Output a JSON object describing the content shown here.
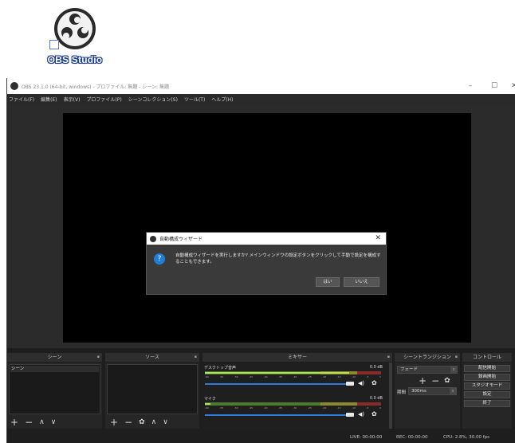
{
  "desktop": {
    "icon_label": "OBS Studio",
    "icon_name": "obs-logo-icon"
  },
  "window": {
    "title": "OBS 23.1.0 (64-bit, windows) - プロファイル: 無題 - シーン: 無題",
    "minimize_glyph": "–",
    "maximize_glyph": "☐",
    "close_glyph": "✕"
  },
  "menu": [
    "ファイル(F)",
    "編集(E)",
    "表示(V)",
    "プロファイル(P)",
    "シーンコレクション(S)",
    "ツール(T)",
    "ヘルプ(H)"
  ],
  "dialog": {
    "title": "自動構成ウィザード",
    "close_glyph": "✕",
    "icon_glyph": "?",
    "message": "自動構成ウィザードを実行しますか? メインウィンドウの設定ボタンをクリックして手動で設定を構成することもできます。",
    "yes_label": "はい",
    "no_label": "いいえ"
  },
  "docks": {
    "scenes": {
      "title": "シーン",
      "items": [
        "シーン"
      ]
    },
    "sources": {
      "title": "ソース"
    },
    "mixer": {
      "title": "ミキサー",
      "tracks": [
        {
          "name": "デスクトップ音声",
          "db": "0.0 dB",
          "level": 0.82,
          "volume": 1.0
        },
        {
          "name": "マイク",
          "db": "0.0 dB",
          "level": 0.03,
          "volume": 1.0
        }
      ],
      "scale": [
        "-60",
        "-55",
        "-50",
        "-45",
        "-40",
        "-35",
        "-30",
        "-25",
        "-20",
        "-15",
        "-10",
        "-5",
        "0"
      ]
    },
    "transitions": {
      "title": "シーントランジション",
      "selected": "フェード",
      "duration_label": "期間",
      "duration_value": "300ms"
    },
    "controls": {
      "title": "コントロール",
      "buttons": [
        "配信開始",
        "録画開始",
        "スタジオモード",
        "設定",
        "終了"
      ]
    }
  },
  "toolbar_glyphs": {
    "add": "+",
    "remove": "−",
    "gear": "✿",
    "up": "∧",
    "down": "∨",
    "volume": "◀)",
    "pin": "▪"
  },
  "status": {
    "live": "LIVE: 00:00:00",
    "rec": "REC: 00:00:00",
    "cpu": "CPU: 2.8%, 30.00 fps"
  },
  "colors": {
    "accent_blue": "#1f7fd6",
    "slider_blue": "#2d7ae0",
    "meter_green": "#4a7a2e",
    "meter_yellow": "#8a8a2a",
    "meter_red": "#8a2a2a"
  }
}
